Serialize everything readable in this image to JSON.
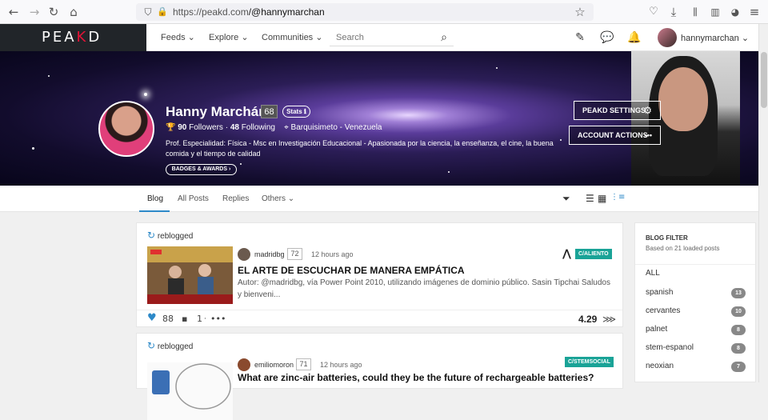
{
  "browser": {
    "url_host": "https://peakd.com",
    "url_path": "/@hannymarchan"
  },
  "nav": {
    "logo_left": "PEA",
    "logo_accent": "K",
    "logo_right": "D",
    "feeds": "Feeds ⌄",
    "explore": "Explore ⌄",
    "communities": "Communities ⌄",
    "search_placeholder": "Search",
    "username": "hannymarchan ⌄"
  },
  "profile": {
    "name": "Hanny Marchán",
    "reputation": "68",
    "stats_label": "Stats ℹ",
    "followers_count": "90",
    "followers_label": "Followers",
    "following_count": "48",
    "following_label": "Following",
    "location": "Barquisimeto - Venezuela",
    "bio": "Prof. Especialidad: Física - Msc en Investigación Educacional - Apasionada por la ciencia, la enseñanza, el cine, la buena comida y el tiempo de calidad",
    "badges_label": "BADGES & AWARDS ›",
    "settings_label": "PEAKD SETTINGS",
    "account_actions_label": "ACCOUNT ACTIONS"
  },
  "tabs": [
    {
      "label": "Blog",
      "active": true
    },
    {
      "label": "All Posts"
    },
    {
      "label": "Replies"
    },
    {
      "label": "Others ⌄"
    }
  ],
  "posts": [
    {
      "reblog_label": "reblogged",
      "author": "madridbg",
      "author_rep": "72",
      "time": "12 hours ago",
      "community": "C/ALIENTO",
      "title": "EL ARTE DE ESCUCHAR DE MANERA EMPÁTICA",
      "body": "Autor: @madridbg, vía Power Point 2010, utilizando imágenes de dominio público. Sasin Tipchai Saludos y bienveni...",
      "votes": "88",
      "comments": "1",
      "payout": "4.29"
    },
    {
      "reblog_label": "reblogged",
      "author": "emiliomoron",
      "author_rep": "71",
      "time": "12 hours ago",
      "community": "C/STEMSOCIAL",
      "title": "What are zinc-air batteries, could they be the future of rechargeable batteries?"
    }
  ],
  "sidebar": {
    "title": "BLOG FILTER",
    "subtitle": "Based on 21 loaded posts",
    "all_label": "ALL",
    "filters": [
      {
        "label": "spanish",
        "count": "13"
      },
      {
        "label": "cervantes",
        "count": "10"
      },
      {
        "label": "palnet",
        "count": "8"
      },
      {
        "label": "stem-espanol",
        "count": "8"
      },
      {
        "label": "neoxian",
        "count": "7"
      }
    ]
  },
  "colors": {
    "accent": "#2d89c8",
    "brand_red": "#e31337",
    "community": "#1aa397"
  }
}
